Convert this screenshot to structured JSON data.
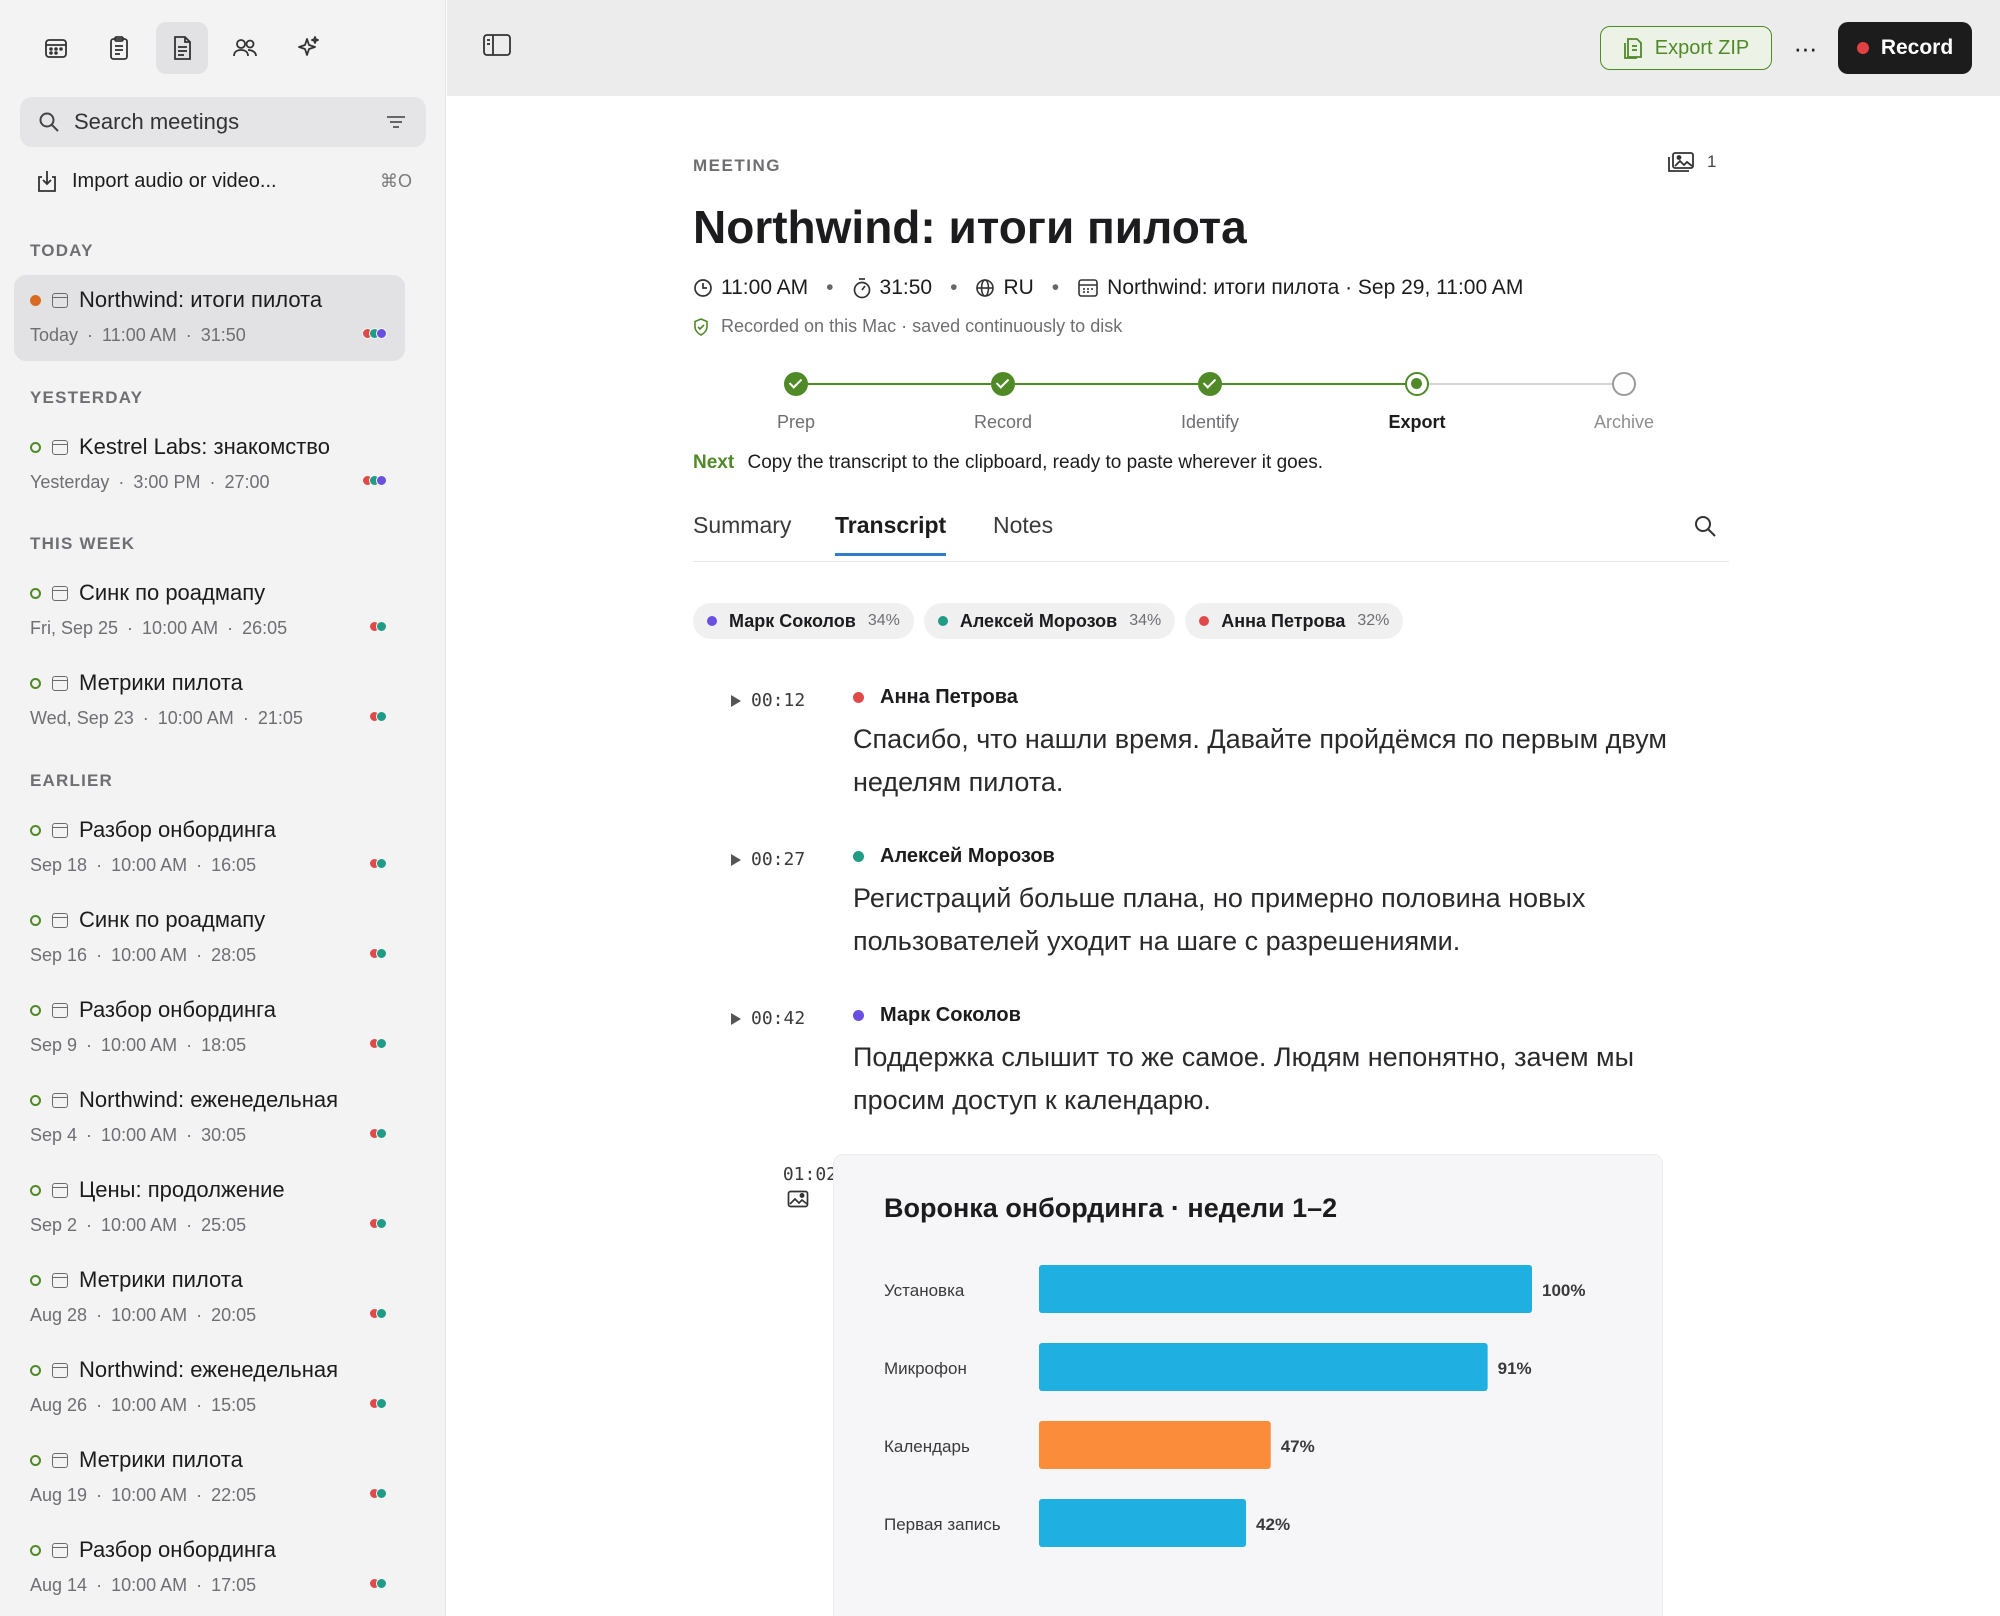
{
  "sidebar": {
    "top_icons": [
      "calendar-icon",
      "clipboard-icon",
      "document-icon",
      "people-icon",
      "sparkles-icon"
    ],
    "search": {
      "placeholder": "Search meetings"
    },
    "import": {
      "label": "Import audio or video...",
      "shortcut": "⌘O"
    },
    "sections": [
      "TODAY",
      "YESTERDAY",
      "THIS WEEK",
      "EARLIER"
    ],
    "meetings": [
      {
        "title": "Northwind: итоги пилота",
        "date": "Today",
        "time": "11:00 AM",
        "duration": "31:50",
        "status": "recording",
        "participants": [
          "#e0494a",
          "#1f9b86",
          "#6a4fe0"
        ]
      },
      {
        "title": "Kestrel Labs: знакомство",
        "date": "Yesterday",
        "time": "3:00 PM",
        "duration": "27:00",
        "status": "done",
        "participants": [
          "#e0494a",
          "#1f9b86",
          "#6a4fe0"
        ]
      },
      {
        "title": "Синк по роадмапу",
        "date": "Fri, Sep 25",
        "time": "10:00 AM",
        "duration": "26:05",
        "status": "done",
        "participants": [
          "#e0494a",
          "#1f9b86"
        ]
      },
      {
        "title": "Метрики пилота",
        "date": "Wed, Sep 23",
        "time": "10:00 AM",
        "duration": "21:05",
        "status": "done",
        "participants": [
          "#e0494a",
          "#1f9b86"
        ]
      },
      {
        "title": "Разбор онбординга",
        "date": "Sep 18",
        "time": "10:00 AM",
        "duration": "16:05",
        "status": "done",
        "participants": [
          "#e0494a",
          "#1f9b86"
        ]
      },
      {
        "title": "Синк по роадмапу",
        "date": "Sep 16",
        "time": "10:00 AM",
        "duration": "28:05",
        "status": "done",
        "participants": [
          "#e0494a",
          "#1f9b86"
        ]
      },
      {
        "title": "Разбор онбординга",
        "date": "Sep 9",
        "time": "10:00 AM",
        "duration": "18:05",
        "status": "done",
        "participants": [
          "#e0494a",
          "#1f9b86"
        ]
      },
      {
        "title": "Northwind: еженедельная",
        "date": "Sep 4",
        "time": "10:00 AM",
        "duration": "30:05",
        "status": "done",
        "participants": [
          "#e0494a",
          "#1f9b86"
        ]
      },
      {
        "title": "Цены: продолжение",
        "date": "Sep 2",
        "time": "10:00 AM",
        "duration": "25:05",
        "status": "done",
        "participants": [
          "#e0494a",
          "#1f9b86"
        ]
      },
      {
        "title": "Метрики пилота",
        "date": "Aug 28",
        "time": "10:00 AM",
        "duration": "20:05",
        "status": "done",
        "participants": [
          "#e0494a",
          "#1f9b86"
        ]
      },
      {
        "title": "Northwind: еженедельная",
        "date": "Aug 26",
        "time": "10:00 AM",
        "duration": "15:05",
        "status": "done",
        "participants": [
          "#e0494a",
          "#1f9b86"
        ]
      },
      {
        "title": "Метрики пилота",
        "date": "Aug 19",
        "time": "10:00 AM",
        "duration": "22:05",
        "status": "done",
        "participants": [
          "#e0494a",
          "#1f9b86"
        ]
      },
      {
        "title": "Разбор онбординга",
        "date": "Aug 14",
        "time": "10:00 AM",
        "duration": "17:05",
        "status": "done",
        "participants": [
          "#e0494a",
          "#1f9b86"
        ]
      }
    ]
  },
  "toolbar": {
    "export_label": "Export ZIP",
    "more_label": "···",
    "record_label": "Record"
  },
  "meeting": {
    "kicker": "MEETING",
    "attachments_count": "1",
    "title": "Northwind: итоги пилота",
    "time": "11:00 AM",
    "duration": "31:50",
    "language": "RU",
    "calendar_event": "Northwind: итоги пилота · Sep 29, 11:00 AM",
    "saved_note": "Recorded on this Mac · saved continuously to disk",
    "steps": [
      {
        "label": "Prep",
        "state": "done"
      },
      {
        "label": "Record",
        "state": "done"
      },
      {
        "label": "Identify",
        "state": "done"
      },
      {
        "label": "Export",
        "state": "current"
      },
      {
        "label": "Archive",
        "state": "todo"
      }
    ],
    "next_label": "Next",
    "next_text": "Copy the transcript to the clipboard, ready to paste wherever it goes.",
    "tabs": [
      "Summary",
      "Transcript",
      "Notes"
    ],
    "active_tab": "Transcript",
    "speakers": [
      {
        "name": "Марк Соколов",
        "share": "34%",
        "color": "#6a4fe0"
      },
      {
        "name": "Алексей Морозов",
        "share": "34%",
        "color": "#1f9b86"
      },
      {
        "name": "Анна Петрова",
        "share": "32%",
        "color": "#e0494a"
      }
    ],
    "transcript": [
      {
        "time": "00:12",
        "speaker": "Анна Петрова",
        "color": "#e0494a",
        "text": "Спасибо, что нашли время. Давайте пройдёмся по первым двум неделям пилота."
      },
      {
        "time": "00:27",
        "speaker": "Алексей Морозов",
        "color": "#1f9b86",
        "text": "Регистраций больше плана, но примерно половина новых пользователей уходит на шаге с разрешениями."
      },
      {
        "time": "00:42",
        "speaker": "Марк Соколов",
        "color": "#6a4fe0",
        "text": "Поддержка слышит то же самое. Людям непонятно, зачем мы просим доступ к календарю."
      }
    ],
    "image_time": "01:02"
  },
  "chart_data": {
    "type": "bar",
    "orientation": "horizontal",
    "title": "Воронка онбординга · недели 1–2",
    "categories": [
      "Установка",
      "Микрофон",
      "Календарь",
      "Первая запись"
    ],
    "values": [
      100,
      91,
      47,
      42
    ],
    "value_labels": [
      "100%",
      "91%",
      "47%",
      "42%"
    ],
    "colors": [
      "#1fafe0",
      "#1fafe0",
      "#fb8c3a",
      "#1fafe0"
    ],
    "xlim": [
      0,
      100
    ],
    "grid": false
  }
}
